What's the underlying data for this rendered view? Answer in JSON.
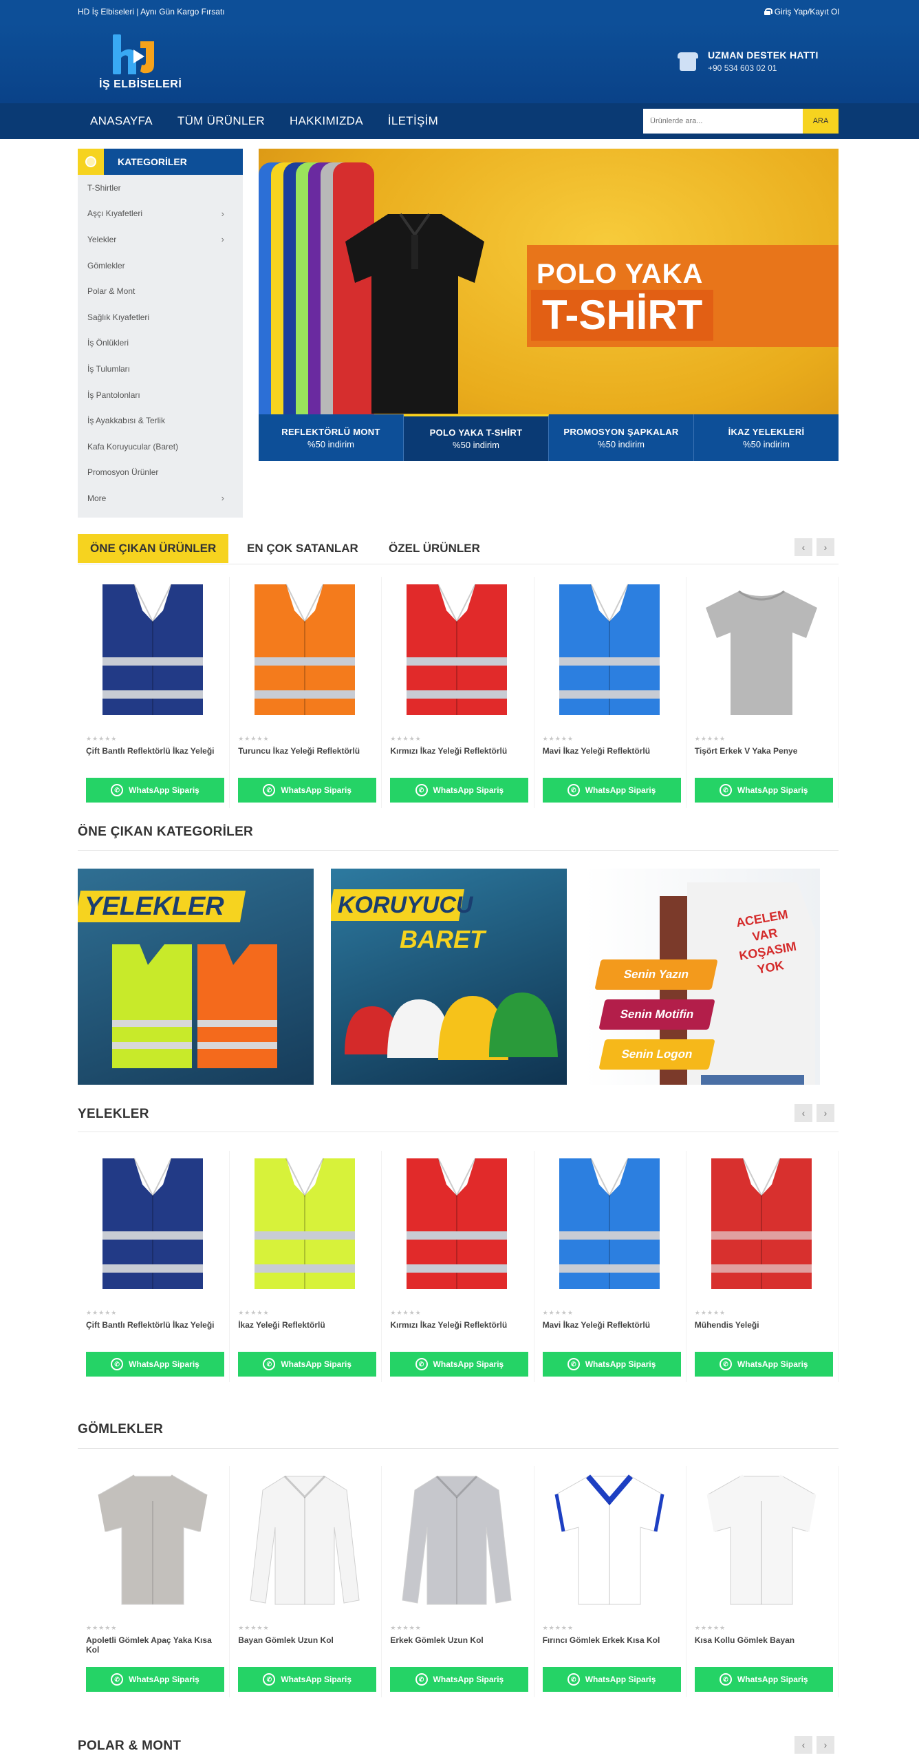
{
  "topbar": {
    "announcement": "HD İş Elbiseleri | Aynı Gün Kargo Fırsatı",
    "login": "Giriş Yap/Kayıt Ol"
  },
  "brand": {
    "logo_text": "İŞ ELBİSELERİ",
    "primary_color": "#0d4f98",
    "accent_color": "#f6d31f"
  },
  "support": {
    "title": "UZMAN DESTEK HATTI",
    "phone": "+90 534 603 02 01"
  },
  "nav": {
    "items": [
      "ANASAYFA",
      "TÜM ÜRÜNLER",
      "HAKKIMIZDA",
      "İLETİŞİM"
    ]
  },
  "search": {
    "placeholder": "Ürünlerde ara...",
    "button": "ARA"
  },
  "sidebar": {
    "title": "KATEGORİLER",
    "items": [
      {
        "label": "T-Shirtler",
        "chevron": ""
      },
      {
        "label": "Aşçı Kıyafetleri",
        "chevron": "›"
      },
      {
        "label": "Yelekler",
        "chevron": "›"
      },
      {
        "label": "Gömlekler",
        "chevron": ""
      },
      {
        "label": "Polar & Mont",
        "chevron": ""
      },
      {
        "label": "Sağlık Kıyafetleri",
        "chevron": ""
      },
      {
        "label": "İş Önlükleri",
        "chevron": ""
      },
      {
        "label": "İş Tulumları",
        "chevron": ""
      },
      {
        "label": "İş Pantolonları",
        "chevron": ""
      },
      {
        "label": "İş Ayakkabısı & Terlik",
        "chevron": ""
      },
      {
        "label": "Kafa Koruyucular (Baret)",
        "chevron": ""
      },
      {
        "label": "Promosyon Ürünler",
        "chevron": ""
      },
      {
        "label": "More",
        "chevron": "›"
      }
    ]
  },
  "hero": {
    "line1": "POLO YAKA",
    "line2": "T-SHİRT",
    "tabs": [
      {
        "name": "REFLEKTÖRLÜ MONT",
        "discount": "%50 indirim"
      },
      {
        "name": "POLO YAKA T-SHİRT",
        "discount": "%50 indirim"
      },
      {
        "name": "PROMOSYON ŞAPKALAR",
        "discount": "%50 indirim"
      },
      {
        "name": "İKAZ YELEKLERİ",
        "discount": "%50 indirim"
      }
    ]
  },
  "product_tabs": [
    "ÖNE ÇIKAN ÜRÜNLER",
    "EN ÇOK SATANLAR",
    "ÖZEL ÜRÜNLER"
  ],
  "whatsapp_label": "WhatsApp Sipariş",
  "featured_products": [
    {
      "name": "Çift Bantlı Reflektörlü İkaz Yeleği",
      "image": "vest-navy"
    },
    {
      "name": "Turuncu İkaz Yeleği Reflektörlü",
      "image": "vest-orange"
    },
    {
      "name": "Kırmızı İkaz Yeleği Reflektörlü",
      "image": "vest-red"
    },
    {
      "name": "Mavi İkaz Yeleği Reflektörlü",
      "image": "vest-blue"
    },
    {
      "name": "Tişört Erkek V Yaka Penye",
      "image": "tshirt-grey"
    }
  ],
  "featured_categories": {
    "title": "ÖNE ÇIKAN KATEGORİLER",
    "banners": [
      {
        "label": "YELEKLER"
      },
      {
        "label1": "KORUYUCU",
        "label2": "BARET"
      },
      {
        "shirt_text": [
          "ACELEM",
          "VAR",
          "KOŞASIM",
          "YOK"
        ],
        "tags": [
          "Senin Yazın",
          "Senin Motifin",
          "Senin Logon"
        ]
      }
    ]
  },
  "yelekler": {
    "title": "YELEKLER",
    "products": [
      {
        "name": "Çift Bantlı Reflektörlü İkaz Yeleği",
        "image": "vest-navy"
      },
      {
        "name": "İkaz Yeleği Reflektörlü",
        "image": "vest-yellow"
      },
      {
        "name": "Kırmızı İkaz Yeleği Reflektörlü",
        "image": "vest-red"
      },
      {
        "name": "Mavi İkaz Yeleği Reflektörlü",
        "image": "vest-blue"
      },
      {
        "name": "Mühendis Yeleği",
        "image": "vest-engineer"
      }
    ]
  },
  "gomlekler": {
    "title": "GÖMLEKLER",
    "products": [
      {
        "name": "Apoletli Gömlek Apaç Yaka Kısa Kol",
        "image": "shirt-grey-short"
      },
      {
        "name": "Bayan Gömlek Uzun Kol",
        "image": "shirt-white-long"
      },
      {
        "name": "Erkek Gömlek Uzun Kol",
        "image": "shirt-grey-long"
      },
      {
        "name": "Fırıncı Gömlek Erkek Kısa Kol",
        "image": "shirt-baker"
      },
      {
        "name": "Kısa Kollu Gömlek Bayan",
        "image": "shirt-white-short"
      }
    ]
  },
  "polar": {
    "title": "POLAR & MONT"
  },
  "arrows": {
    "prev": "‹",
    "next": "›"
  }
}
